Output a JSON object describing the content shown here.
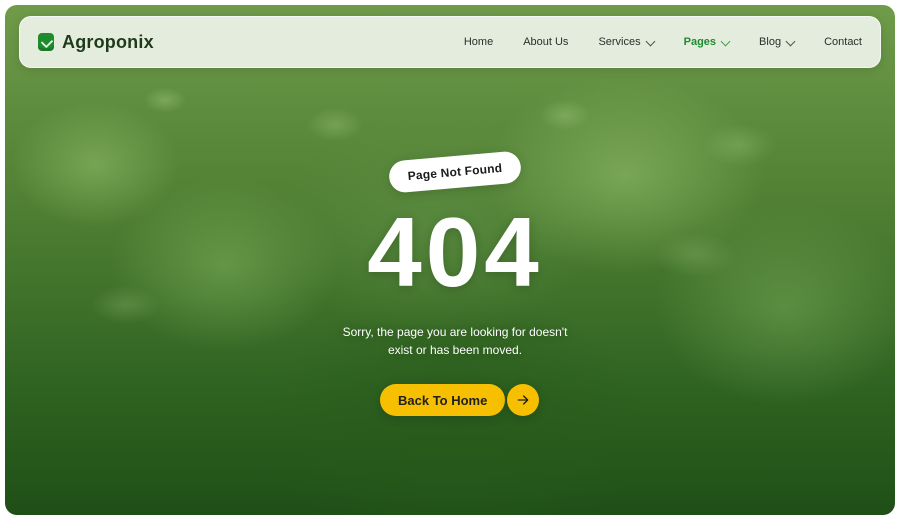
{
  "brand": {
    "name": "Agroponix",
    "icon": "leaf-logo-icon",
    "accent_color": "#1E8B2F"
  },
  "nav": {
    "items": [
      {
        "label": "Home",
        "active": false,
        "has_dropdown": false
      },
      {
        "label": "About Us",
        "active": false,
        "has_dropdown": false
      },
      {
        "label": "Services",
        "active": false,
        "has_dropdown": true
      },
      {
        "label": "Pages",
        "active": true,
        "has_dropdown": true
      },
      {
        "label": "Blog",
        "active": false,
        "has_dropdown": true
      },
      {
        "label": "Contact",
        "active": false,
        "has_dropdown": false
      }
    ]
  },
  "hero": {
    "badge": "Page Not Found",
    "code": "404",
    "message_line1": "Sorry, the page you are looking for doesn't",
    "message_line2": "exist or has been moved.",
    "cta_label": "Back To Home",
    "cta_icon": "arrow-right-icon",
    "cta_color": "#F6C000"
  }
}
